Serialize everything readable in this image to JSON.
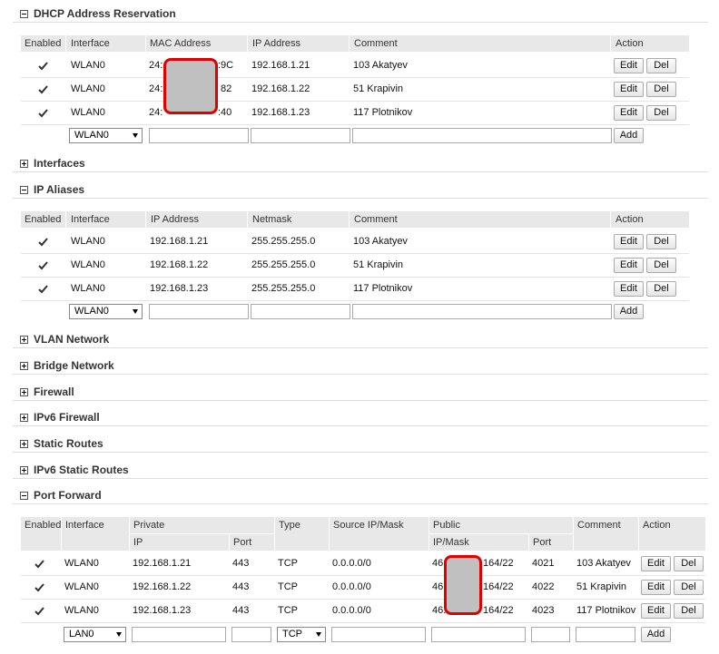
{
  "dhcp": {
    "title": "DHCP Address Reservation",
    "headers": [
      "Enabled",
      "Interface",
      "MAC Address",
      "IP Address",
      "Comment",
      "Action"
    ],
    "rows": [
      {
        "iface": "WLAN0",
        "mac_a": "24:",
        "mac_b": ":9C",
        "ip": "192.168.1.21",
        "comment": "103 Akatyev"
      },
      {
        "iface": "WLAN0",
        "mac_a": "24:",
        "mac_b": "82",
        "ip": "192.168.1.22",
        "comment": "51 Krapivin"
      },
      {
        "iface": "WLAN0",
        "mac_a": "24:",
        "mac_b": ":40",
        "ip": "192.168.1.23",
        "comment": "117 Plotnikov"
      }
    ],
    "new_iface": "WLAN0"
  },
  "interfaces_title": "Interfaces",
  "aliases": {
    "title": "IP Aliases",
    "headers": [
      "Enabled",
      "Interface",
      "IP Address",
      "Netmask",
      "Comment",
      "Action"
    ],
    "rows": [
      {
        "iface": "WLAN0",
        "ip": "192.168.1.21",
        "mask": "255.255.255.0",
        "comment": "103 Akatyev"
      },
      {
        "iface": "WLAN0",
        "ip": "192.168.1.22",
        "mask": "255.255.255.0",
        "comment": "51 Krapivin"
      },
      {
        "iface": "WLAN0",
        "ip": "192.168.1.23",
        "mask": "255.255.255.0",
        "comment": "117 Plotnikov"
      }
    ],
    "new_iface": "WLAN0"
  },
  "collapsed": [
    "VLAN Network",
    "Bridge Network",
    "Firewall",
    "IPv6 Firewall",
    "Static Routes",
    "IPv6 Static Routes"
  ],
  "portfwd": {
    "title": "Port Forward",
    "headers": [
      "Enabled",
      "Interface",
      "Private",
      "Type",
      "Source IP/Mask",
      "Public",
      "Comment",
      "Action"
    ],
    "subheaders": {
      "private_ip": "IP",
      "private_port": "Port",
      "public_ip": "IP/Mask",
      "public_port": "Port"
    },
    "rows": [
      {
        "iface": "WLAN0",
        "pip": "192.168.1.21",
        "pport": "443",
        "type": "TCP",
        "src": "0.0.0.0/0",
        "pub_a": "46",
        "pub_b": "164/22",
        "pubport": "4021",
        "comment": "103 Akatyev"
      },
      {
        "iface": "WLAN0",
        "pip": "192.168.1.22",
        "pport": "443",
        "type": "TCP",
        "src": "0.0.0.0/0",
        "pub_a": "46",
        "pub_b": "164/22",
        "pubport": "4022",
        "comment": "51 Krapivin"
      },
      {
        "iface": "WLAN0",
        "pip": "192.168.1.23",
        "pport": "443",
        "type": "TCP",
        "src": "0.0.0.0/0",
        "pub_a": "46.",
        "pub_b": "164/22",
        "pubport": "4023",
        "comment": "117 Plotnikov"
      }
    ],
    "new_iface": "LAN0",
    "new_type": "TCP"
  },
  "buttons": {
    "edit": "Edit",
    "del": "Del",
    "add": "Add"
  },
  "icons": {
    "expanded": "minus-box-icon",
    "collapsed": "plus-box-icon",
    "checkbox": "checkbox-checked-icon"
  }
}
